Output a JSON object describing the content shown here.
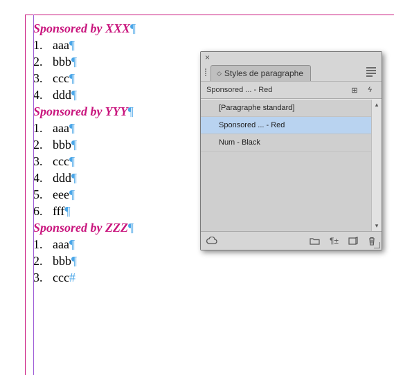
{
  "document": {
    "sections": [
      {
        "heading": "Sponsored by XXX",
        "items": [
          "aaa",
          "bbb",
          "ccc",
          "ddd"
        ],
        "endMarker": "pilcrow"
      },
      {
        "heading": "Sponsored by YYY",
        "items": [
          "aaa",
          "bbb",
          "ccc",
          "ddd",
          "eee",
          "fff"
        ],
        "endMarker": "pilcrow"
      },
      {
        "heading": "Sponsored by ZZZ",
        "items": [
          "aaa",
          "bbb",
          "ccc"
        ],
        "endMarker": "hash"
      }
    ],
    "pilcrow": "¶",
    "hash": "#"
  },
  "panel": {
    "title": "Styles de paragraphe",
    "filter": "Sponsored ... - Red",
    "styles": [
      {
        "label": "[Paragraphe standard]",
        "selected": false
      },
      {
        "label": "Sponsored ... - Red",
        "selected": true
      },
      {
        "label": "Num - Black",
        "selected": false
      }
    ],
    "icons": {
      "close": "×",
      "expander": "◇",
      "newBoxed": "⊞",
      "flash": "⚡",
      "cloud": "☁",
      "folder": "folder",
      "clearOverrides": "¶+",
      "newStyle": "new",
      "trash": "trash"
    }
  }
}
